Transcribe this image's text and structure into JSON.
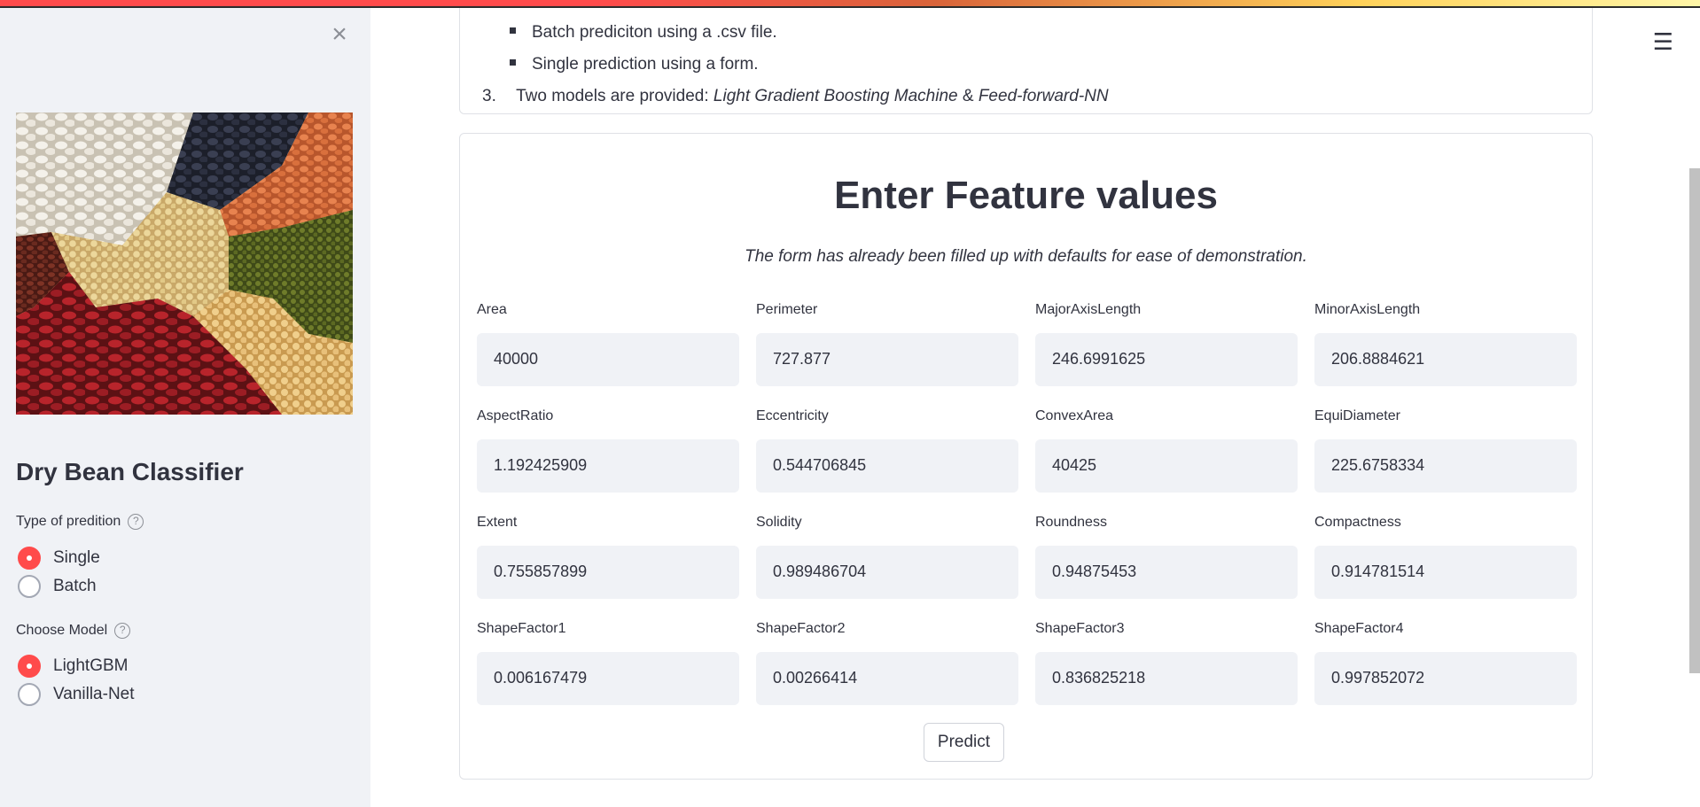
{
  "sidebar": {
    "title": "Dry Bean Classifier",
    "prediction_type": {
      "label": "Type of predition",
      "options": [
        "Single",
        "Batch"
      ],
      "selected": "Single"
    },
    "model": {
      "label": "Choose Model",
      "options": [
        "LightGBM",
        "Vanilla-Net"
      ],
      "selected": "LightGBM"
    }
  },
  "description": {
    "bullet1": "Batch prediciton using a .csv file.",
    "bullet2": "Single prediction using a form.",
    "item3_number": "3.",
    "item3_prefix": "Two models are provided: ",
    "item3_model1": "Light Gradient Boosting Machine",
    "item3_amp": " & ",
    "item3_model2": "Feed-forward-NN"
  },
  "form": {
    "title": "Enter Feature values",
    "subtitle": "The form has already been filled up with defaults for ease of demonstration.",
    "fields": [
      {
        "label": "Area",
        "value": "40000"
      },
      {
        "label": "Perimeter",
        "value": "727.877"
      },
      {
        "label": "MajorAxisLength",
        "value": "246.6991625"
      },
      {
        "label": "MinorAxisLength",
        "value": "206.8884621"
      },
      {
        "label": "AspectRatio",
        "value": "1.192425909"
      },
      {
        "label": "Eccentricity",
        "value": "0.544706845"
      },
      {
        "label": "ConvexArea",
        "value": "40425"
      },
      {
        "label": "EquiDiameter",
        "value": "225.6758334"
      },
      {
        "label": "Extent",
        "value": "0.755857899"
      },
      {
        "label": "Solidity",
        "value": "0.989486704"
      },
      {
        "label": "Roundness",
        "value": "0.94875453"
      },
      {
        "label": "Compactness",
        "value": "0.914781514"
      },
      {
        "label": "ShapeFactor1",
        "value": "0.006167479"
      },
      {
        "label": "ShapeFactor2",
        "value": "0.00266414"
      },
      {
        "label": "ShapeFactor3",
        "value": "0.836825218"
      },
      {
        "label": "ShapeFactor4",
        "value": "0.997852072"
      }
    ],
    "predict_label": "Predict"
  },
  "icons": {
    "close": "close-icon",
    "help": "help-icon",
    "menu": "hamburger-menu-icon"
  },
  "colors": {
    "accent": "#ff4b4b",
    "sidebar_bg": "#f0f2f6",
    "input_bg": "#f0f2f6",
    "text": "#31333f"
  }
}
